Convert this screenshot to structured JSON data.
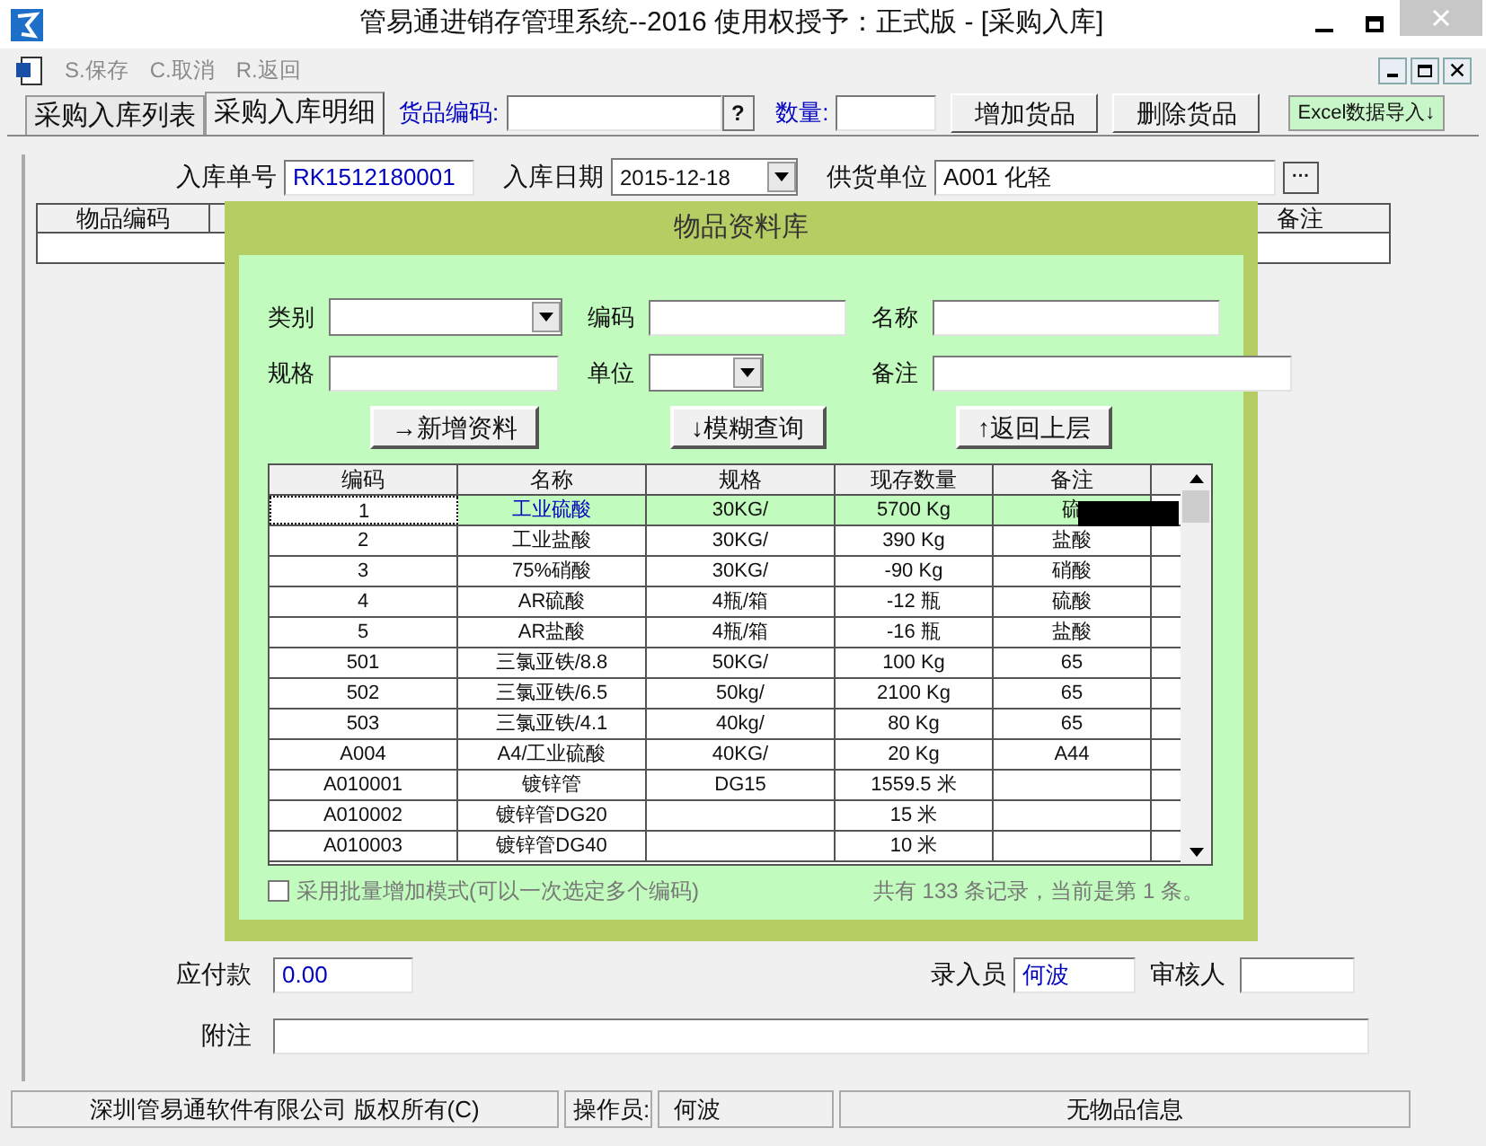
{
  "window": {
    "title": "管易通进销存管理系统--2016  使用权授予：正式版 - [采购入库]"
  },
  "toolbar": [
    {
      "label": "S.保存",
      "disabled": true
    },
    {
      "label": "C.取消",
      "disabled": true
    },
    {
      "label": "R.返回",
      "disabled": true
    }
  ],
  "tabs": [
    {
      "label": "采购入库列表",
      "selected": false
    },
    {
      "label": "采购入库明细",
      "selected": true
    }
  ],
  "item_bar": {
    "code_label": "货品编码:",
    "help": "?",
    "qty_label": "数量:",
    "buttons": [
      "增加货品",
      "删除货品"
    ],
    "import_button": "Excel数据导入↓"
  },
  "header_fields": [
    {
      "label": "入库单号",
      "value": "RK1512180001"
    },
    {
      "label": "入库日期",
      "value": "2015-12-18"
    },
    {
      "label": "供货单位",
      "value": "A001 化轻",
      "button": "···"
    }
  ],
  "detail_columns": [
    "物品编码",
    "备注"
  ],
  "dialog": {
    "title": "物品资料库",
    "filters": [
      {
        "label": "类别",
        "kind": "select"
      },
      {
        "label": "编码",
        "kind": "text"
      },
      {
        "label": "名称",
        "kind": "text"
      },
      {
        "label": "规格",
        "kind": "text"
      },
      {
        "label": "单位",
        "kind": "select"
      },
      {
        "label": "备注",
        "kind": "text"
      }
    ],
    "buttons": [
      "→新增资料",
      "↓模糊查询",
      "↑返回上层"
    ],
    "columns": [
      "编码",
      "名称",
      "规格",
      "现存数量",
      "备注"
    ],
    "rows": [
      {
        "cells": [
          "1",
          "工业硫酸",
          "30KG/",
          "5700 Kg",
          "硫"
        ],
        "selected": true
      },
      {
        "cells": [
          "2",
          "工业盐酸",
          "30KG/",
          "390 Kg",
          "盐酸"
        ],
        "selected": false
      },
      {
        "cells": [
          "3",
          "75%硝酸",
          "30KG/",
          "-90 Kg",
          "硝酸"
        ],
        "selected": false
      },
      {
        "cells": [
          "4",
          "AR硫酸",
          "4瓶/箱",
          "-12 瓶",
          "硫酸"
        ],
        "selected": false
      },
      {
        "cells": [
          "5",
          "AR盐酸",
          "4瓶/箱",
          "-16 瓶",
          "盐酸"
        ],
        "selected": false
      },
      {
        "cells": [
          "501",
          "三氯亚铁/8.8",
          "50KG/",
          "100 Kg",
          "65"
        ],
        "selected": false
      },
      {
        "cells": [
          "502",
          "三氯亚铁/6.5",
          "50kg/",
          "2100 Kg",
          "65"
        ],
        "selected": false
      },
      {
        "cells": [
          "503",
          "三氯亚铁/4.1",
          "40kg/",
          "80 Kg",
          "65"
        ],
        "selected": false
      },
      {
        "cells": [
          "A004",
          "A4/工业硫酸",
          "40KG/",
          "20 Kg",
          "A44"
        ],
        "selected": false
      },
      {
        "cells": [
          "A010001",
          "镀锌管",
          "DG15",
          "1559.5 米",
          ""
        ],
        "selected": false
      },
      {
        "cells": [
          "A010002",
          "镀锌管DG20",
          "",
          "15 米",
          ""
        ],
        "selected": false
      },
      {
        "cells": [
          "A010003",
          "镀锌管DG40",
          "",
          "10 米",
          ""
        ],
        "selected": false
      }
    ],
    "batch_mode": {
      "label": "采用批量增加模式(可以一次选定多个编码)",
      "checked": false
    },
    "record_info": "共有 133 条记录，当前是第 1 条。"
  },
  "footer_fields": [
    {
      "label": "应付款",
      "value": "0.00"
    },
    {
      "label": "录入员",
      "value": "何波"
    },
    {
      "label": "审核人"
    },
    {
      "label": "附注"
    }
  ],
  "status_bar": [
    "深圳管易通软件有限公司 版权所有(C)",
    "操作员:",
    "何波",
    "无物品信息"
  ]
}
